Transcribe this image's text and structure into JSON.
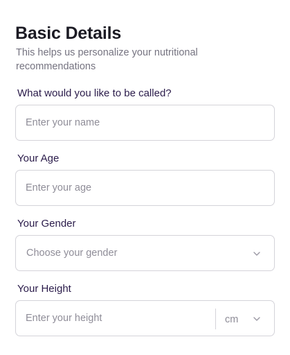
{
  "header": {
    "title": "Basic Details",
    "subtitle": "This helps us personalize your nutritional recommendations"
  },
  "form": {
    "name": {
      "label": "What would you like to be called?",
      "placeholder": "Enter your name",
      "value": ""
    },
    "age": {
      "label": "Your Age",
      "placeholder": "Enter your age",
      "value": ""
    },
    "gender": {
      "label": "Your Gender",
      "placeholder": "Choose your gender",
      "icon": "chevron-down-icon"
    },
    "height": {
      "label": "Your Height",
      "placeholder": "Enter your height",
      "value": "",
      "unit": "cm",
      "icon": "chevron-down-icon"
    }
  },
  "colors": {
    "title": "#1c1b24",
    "label": "#2a1b4a",
    "subtitle": "#757380",
    "placeholder": "#8f8d98",
    "border": "#d4d3d9"
  }
}
